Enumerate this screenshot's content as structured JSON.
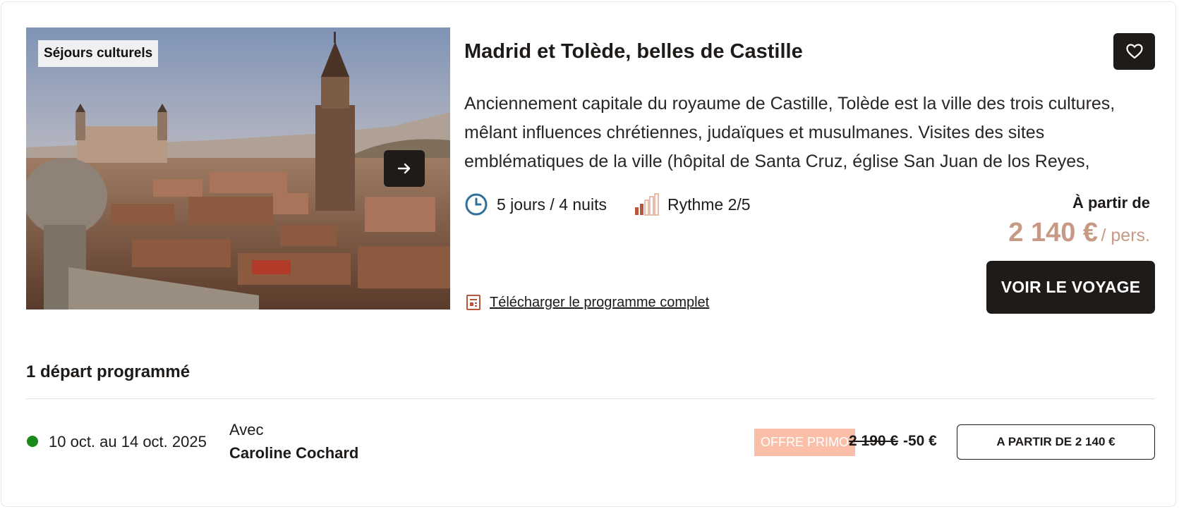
{
  "card": {
    "category_badge": "Séjours culturels",
    "title": "Madrid et Tolède, belles de Castille",
    "description": "Anciennement capitale du royaume de Castille, Tolède est la ville des trois cultures, mêlant influences chrétiennes, judaïques et musulmanes. Visites des sites emblématiques de la ville (hôpital de Santa Cruz, église San Juan de los Reyes, synagogue Santa María la Blanca)…",
    "duration": "5 jours / 4 nuits",
    "rhythm": "Rythme 2/5",
    "rhythm_level": 2,
    "rhythm_max": 5,
    "price_label": "À partir de",
    "price": "2 140 €",
    "price_unit": "/ pers.",
    "cta_label": "VOIR LE VOYAGE",
    "download_label": "Télécharger le programme complet",
    "icons": {
      "next": "arrow-right-icon",
      "favorite": "heart-icon",
      "duration": "clock-icon",
      "rhythm": "rhythm-bars-icon",
      "download": "document-icon"
    }
  },
  "departures": {
    "title": "1 départ programmé",
    "items": [
      {
        "dates": "10 oct. au 14 oct. 2025",
        "status_color": "#1a8a1a",
        "guide_label": "Avec",
        "guide_name": "Caroline Cochard",
        "promo_label": "OFFRE PRIMO",
        "old_price": "2 190 €",
        "discount": "-50 €",
        "cta_label": "A PARTIR DE 2 140 €"
      }
    ]
  },
  "colors": {
    "dark": "#1f1b19",
    "accent_price": "#c79a86",
    "promo_bg": "#fbbfa9",
    "icon_blue": "#2f6f9a",
    "icon_terracotta": "#b8553a"
  }
}
